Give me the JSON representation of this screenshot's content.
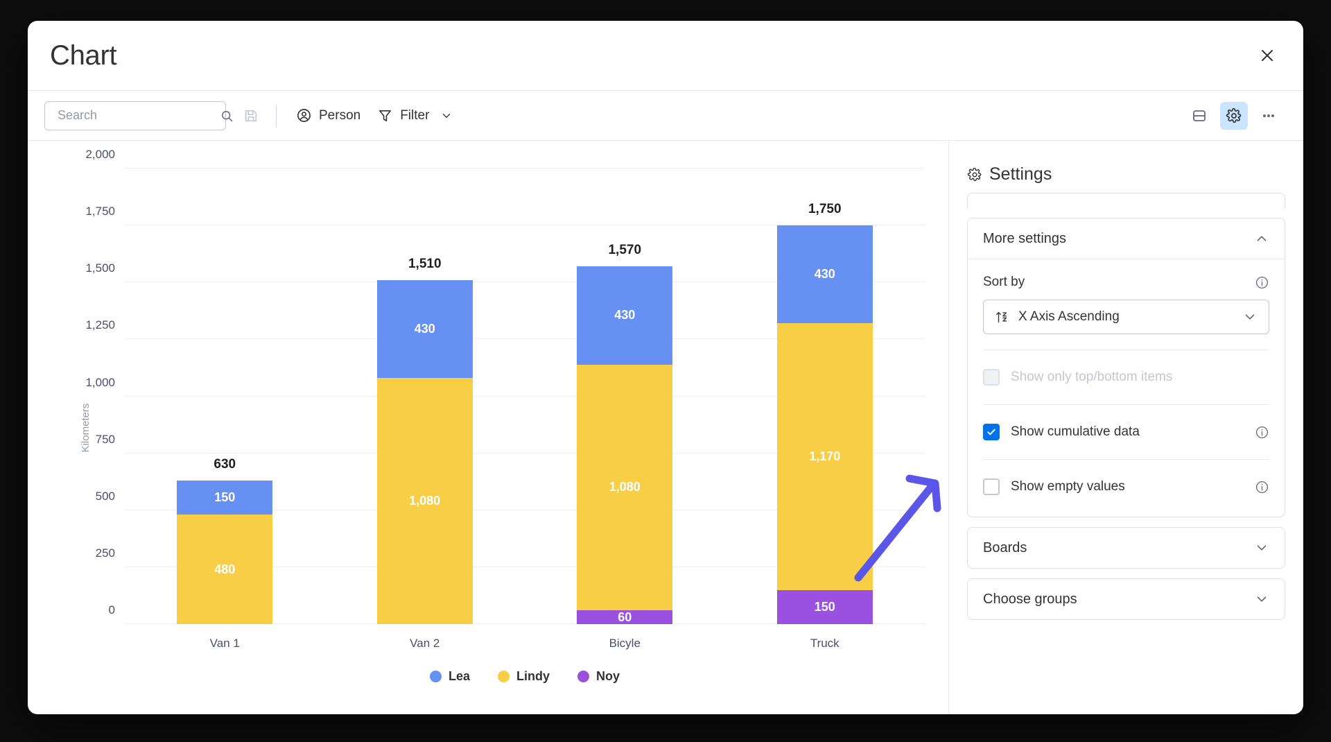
{
  "window": {
    "title": "Chart",
    "close_icon": "close-icon"
  },
  "toolbar": {
    "search_placeholder": "Search",
    "search_value": "",
    "search_icon": "search-icon",
    "save_icon": "save-icon",
    "person_label": "Person",
    "person_icon": "person-icon",
    "filter_label": "Filter",
    "filter_icon": "filter-icon",
    "filter_chevron_icon": "chevron-down-icon",
    "split_view_icon": "split-view-icon",
    "settings_icon": "gear-icon",
    "more_icon": "more-horizontal-icon",
    "accent_active_bg": "#cce5ff"
  },
  "settings": {
    "title": "Settings",
    "title_icon": "gear-icon",
    "more_settings": {
      "label": "More settings",
      "expanded": true,
      "chevron_icon": "chevron-up-icon",
      "sort_by": {
        "label": "Sort by",
        "info_icon": "info-icon",
        "value": "X Axis Ascending",
        "value_icon": "sort-ascending-az-icon",
        "chevron_icon": "chevron-down-icon"
      },
      "options": [
        {
          "label": "Show only top/bottom items",
          "checked": false,
          "disabled": true,
          "info_icon": null
        },
        {
          "label": "Show cumulative data",
          "checked": true,
          "disabled": false,
          "info_icon": "info-icon"
        },
        {
          "label": "Show empty values",
          "checked": false,
          "disabled": false,
          "info_icon": "info-icon"
        }
      ]
    },
    "collapsed_sections": [
      {
        "label": "Boards",
        "chevron_icon": "chevron-down-icon"
      },
      {
        "label": "Choose groups",
        "chevron_icon": "chevron-down-icon"
      }
    ]
  },
  "annotation": {
    "type": "hand-drawn-arrow",
    "color": "#5b55e8",
    "points_to": "show-cumulative-data-checkbox"
  },
  "chart_data": {
    "type": "bar",
    "stacked": true,
    "title": "",
    "xlabel": "",
    "ylabel": "Kilometers",
    "ylim": [
      0,
      2000
    ],
    "yticks": [
      0,
      250,
      500,
      750,
      1000,
      1250,
      1500,
      1750,
      2000
    ],
    "ytick_labels": [
      "0",
      "250",
      "500",
      "750",
      "1,000",
      "1,250",
      "1,500",
      "1,750",
      "2,000"
    ],
    "grid": true,
    "legend_position": "bottom",
    "categories": [
      "Van 1",
      "Van 2",
      "Bicyle",
      "Truck"
    ],
    "series": [
      {
        "name": "Noy",
        "color": "#9b51e0",
        "values": [
          0,
          0,
          60,
          150
        ],
        "labels": [
          "",
          "",
          "60",
          "150"
        ]
      },
      {
        "name": "Lindy",
        "color": "#f7ce46",
        "values": [
          480,
          1080,
          1080,
          1170
        ],
        "labels": [
          "480",
          "1,080",
          "1,080",
          "1,170"
        ]
      },
      {
        "name": "Lea",
        "color": "#6691f2",
        "values": [
          150,
          430,
          430,
          430
        ],
        "labels": [
          "150",
          "430",
          "430",
          "430"
        ]
      }
    ],
    "totals": [
      630,
      1510,
      1570,
      1750
    ],
    "total_labels": [
      "630",
      "1,510",
      "1,570",
      "1,750"
    ],
    "legend": [
      {
        "name": "Lea",
        "color": "#6691f2"
      },
      {
        "name": "Lindy",
        "color": "#f7ce46"
      },
      {
        "name": "Noy",
        "color": "#9b51e0"
      }
    ]
  }
}
